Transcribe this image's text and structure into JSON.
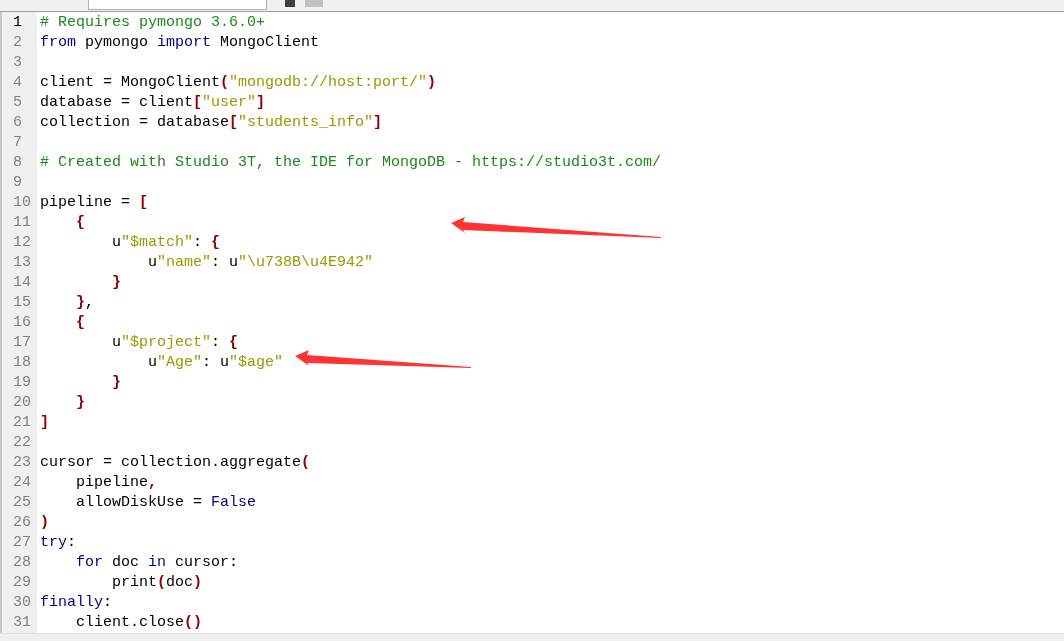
{
  "editor": {
    "lines": [
      {
        "number": "1",
        "tokens": [
          {
            "kind": "comment",
            "text": "# Requires pymongo 3.6.0+"
          }
        ]
      },
      {
        "number": "2",
        "tokens": [
          {
            "kind": "keyword",
            "text": "from"
          },
          {
            "kind": "plain",
            "text": " pymongo "
          },
          {
            "kind": "keyword",
            "text": "import"
          },
          {
            "kind": "plain",
            "text": " MongoClient"
          }
        ]
      },
      {
        "number": "3"
      },
      {
        "number": "4",
        "tokens": [
          {
            "kind": "plain",
            "text": "client = MongoClient"
          },
          {
            "kind": "bracket",
            "text": "("
          },
          {
            "kind": "string",
            "text": "\"mongodb://host:port/\""
          },
          {
            "kind": "bracket",
            "text": ")"
          }
        ]
      },
      {
        "number": "5",
        "tokens": [
          {
            "kind": "plain",
            "text": "database = client"
          },
          {
            "kind": "bracket",
            "text": "["
          },
          {
            "kind": "string",
            "text": "\"user\""
          },
          {
            "kind": "bracket",
            "text": "]"
          }
        ]
      },
      {
        "number": "6",
        "tokens": [
          {
            "kind": "plain",
            "text": "collection = database"
          },
          {
            "kind": "bracket",
            "text": "["
          },
          {
            "kind": "string",
            "text": "\"students_info\""
          },
          {
            "kind": "bracket",
            "text": "]"
          }
        ]
      },
      {
        "number": "7"
      },
      {
        "number": "8",
        "tokens": [
          {
            "kind": "comment",
            "text": "# Created with Studio 3T, the IDE for MongoDB - https://studio3t.com/"
          }
        ]
      },
      {
        "number": "9"
      },
      {
        "number": "10",
        "tokens": [
          {
            "kind": "plain",
            "text": "pipeline = "
          },
          {
            "kind": "bracket",
            "text": "["
          }
        ]
      },
      {
        "number": "11",
        "tokens": [
          {
            "kind": "bracket",
            "text": "    {"
          }
        ]
      },
      {
        "number": "12",
        "tokens": [
          {
            "kind": "plain",
            "text": "        u"
          },
          {
            "kind": "string",
            "text": "\"$match\""
          },
          {
            "kind": "plain",
            "text": ": "
          },
          {
            "kind": "bracket",
            "text": "{"
          }
        ]
      },
      {
        "number": "13",
        "tokens": [
          {
            "kind": "plain",
            "text": "            u"
          },
          {
            "kind": "string",
            "text": "\"name\""
          },
          {
            "kind": "plain",
            "text": ": u"
          },
          {
            "kind": "string",
            "text": "\"\\u738B\\u4E942\""
          }
        ]
      },
      {
        "number": "14",
        "tokens": [
          {
            "kind": "bracket",
            "text": "        }"
          }
        ]
      },
      {
        "number": "15",
        "tokens": [
          {
            "kind": "bracket",
            "text": "    }"
          },
          {
            "kind": "plain",
            "text": ","
          }
        ]
      },
      {
        "number": "16",
        "tokens": [
          {
            "kind": "bracket",
            "text": "    {"
          }
        ]
      },
      {
        "number": "17",
        "tokens": [
          {
            "kind": "plain",
            "text": "        u"
          },
          {
            "kind": "string",
            "text": "\"$project\""
          },
          {
            "kind": "plain",
            "text": ": "
          },
          {
            "kind": "bracket",
            "text": "{"
          }
        ]
      },
      {
        "number": "18",
        "tokens": [
          {
            "kind": "plain",
            "text": "            u"
          },
          {
            "kind": "string",
            "text": "\"Age\""
          },
          {
            "kind": "plain",
            "text": ": u"
          },
          {
            "kind": "string",
            "text": "\"$age\""
          }
        ]
      },
      {
        "number": "19",
        "tokens": [
          {
            "kind": "bracket",
            "text": "        }"
          }
        ]
      },
      {
        "number": "20",
        "tokens": [
          {
            "kind": "bracket",
            "text": "    }"
          }
        ]
      },
      {
        "number": "21",
        "tokens": [
          {
            "kind": "bracket",
            "text": "]"
          }
        ]
      },
      {
        "number": "22"
      },
      {
        "number": "23",
        "tokens": [
          {
            "kind": "plain",
            "text": "cursor = collection.aggregate"
          },
          {
            "kind": "bracket",
            "text": "("
          }
        ]
      },
      {
        "number": "24",
        "tokens": [
          {
            "kind": "plain",
            "text": "    pipeline"
          },
          {
            "kind": "bracket",
            "text": ","
          }
        ]
      },
      {
        "number": "25",
        "tokens": [
          {
            "kind": "plain",
            "text": "    allowDiskUse = "
          },
          {
            "kind": "keyword",
            "text": "False"
          }
        ]
      },
      {
        "number": "26",
        "tokens": [
          {
            "kind": "bracket",
            "text": ")"
          }
        ]
      },
      {
        "number": "27",
        "tokens": [
          {
            "kind": "keyword",
            "text": "try"
          },
          {
            "kind": "plain",
            "text": ":"
          }
        ]
      },
      {
        "number": "28",
        "tokens": [
          {
            "kind": "keyword",
            "text": "    for"
          },
          {
            "kind": "plain",
            "text": " doc "
          },
          {
            "kind": "keyword",
            "text": "in"
          },
          {
            "kind": "plain",
            "text": " cursor:"
          }
        ]
      },
      {
        "number": "29",
        "tokens": [
          {
            "kind": "plain",
            "text": "        print"
          },
          {
            "kind": "bracket",
            "text": "("
          },
          {
            "kind": "plain",
            "text": "doc"
          },
          {
            "kind": "bracket",
            "text": ")"
          }
        ]
      },
      {
        "number": "30",
        "tokens": [
          {
            "kind": "keyword",
            "text": "finally"
          },
          {
            "kind": "plain",
            "text": ":"
          }
        ]
      },
      {
        "number": "31",
        "tokens": [
          {
            "kind": "plain",
            "text": "    client.close"
          },
          {
            "kind": "bracket",
            "text": "()"
          }
        ]
      }
    ]
  }
}
